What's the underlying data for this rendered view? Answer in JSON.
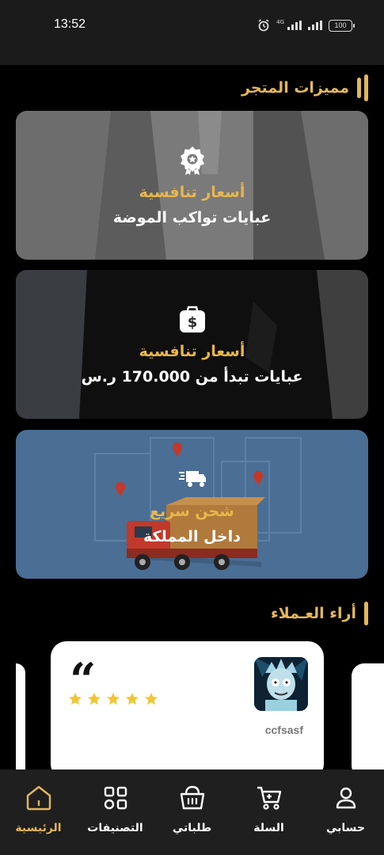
{
  "status_bar": {
    "time": "13:52",
    "network_label": "4G",
    "battery": "100"
  },
  "features_section": {
    "title": "مميزات المتجر",
    "cards": [
      {
        "icon": "award-badge-icon",
        "title": "أسعار تنافسية",
        "subtitle": "عبايات تواكب الموضة"
      },
      {
        "icon": "money-bag-icon",
        "title": "أسعار تنافسية",
        "subtitle": "عبايات تبدأ من 170.000 ر.س"
      },
      {
        "icon": "fast-shipping-icon",
        "title": "شحن سريع",
        "subtitle": "داخل المملكة"
      }
    ]
  },
  "reviews_section": {
    "title": "أراء العـملاء",
    "reviews": [
      {
        "name": "ccfsasf",
        "rating": 5
      }
    ]
  },
  "bottom_nav": {
    "items": [
      {
        "label": "حسابي",
        "icon": "user-icon",
        "active": false
      },
      {
        "label": "السلة",
        "icon": "cart-icon",
        "active": false
      },
      {
        "label": "طلباتي",
        "icon": "basket-icon",
        "active": false
      },
      {
        "label": "التصنيفات",
        "icon": "grid-icon",
        "active": false
      },
      {
        "label": "الرئيسية",
        "icon": "home-icon",
        "active": true
      }
    ]
  },
  "colors": {
    "accent": "#e3b75a",
    "background": "#000000",
    "nav_background": "#1f1f1f"
  }
}
